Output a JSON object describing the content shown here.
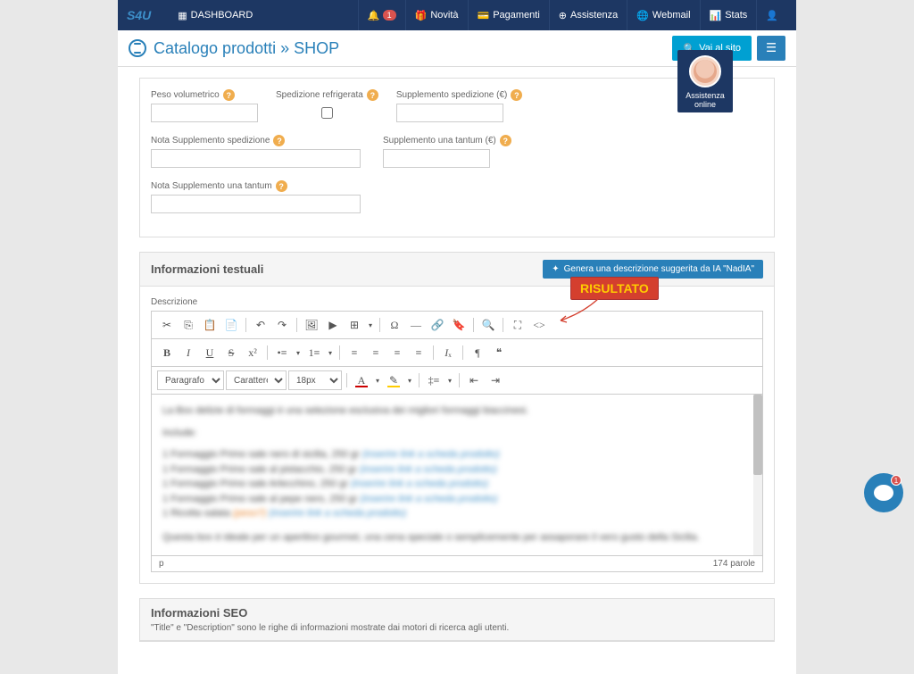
{
  "nav": {
    "brand": "S4U",
    "dashboard": "DASHBOARD",
    "bell_count": "1",
    "novita": "Novità",
    "pagamenti": "Pagamenti",
    "assistenza": "Assistenza",
    "webmail": "Webmail",
    "stats": "Stats"
  },
  "titlebar": {
    "title": "Catalogo prodotti » SHOP",
    "go_site": "Vai al sito"
  },
  "shipping": {
    "peso_label": "Peso volumetrico",
    "refrigerata_label": "Spedizione refrigerata",
    "supplemento_label": "Supplemento spedizione (€)",
    "nota_supp_label": "Nota Supplemento spedizione",
    "una_tantum_label": "Supplemento una tantum (€)",
    "nota_tantum_label": "Nota Supplemento una tantum"
  },
  "textual": {
    "title": "Informazioni testuali",
    "ai_btn": "Genera una descrizione suggerita da IA \"NadIA\"",
    "desc_label": "Descrizione",
    "paragraph": "Paragrafo",
    "font_family": "Carattere di si...",
    "font_size": "18px",
    "status_path": "p",
    "word_count": "174 parole",
    "body": {
      "intro": "La Box delizie di formaggi è una selezione esclusiva dei migliori formaggi biaccinesi.",
      "include": "Include:",
      "items": [
        {
          "t": "1 Formaggio Primo sale nero di sicilia, 250 gr",
          "l": "(inserire link a scheda prodotto)"
        },
        {
          "t": "1 Formaggio Primo sale al pistacchio, 250 gr",
          "l": "(inserire link a scheda prodotto)"
        },
        {
          "t": "1 Formaggio Primo sale Arlecchino, 250 gr",
          "l": "(inserire link a scheda prodotto)"
        },
        {
          "t": "1 Formaggio Primo sale al pepe nero, 250 gr",
          "l": "(inserire link a scheda prodotto)"
        },
        {
          "t": "1 Ricotta salata",
          "o": "(peso?)",
          "l": "(inserire link a scheda prodotto)"
        }
      ],
      "outro": "Questa box è ideale per un aperitivo gourmet, una cena speciale o semplicemente per assaporare il vero gusto della Sicilia."
    }
  },
  "seo": {
    "title": "Informazioni SEO",
    "subtitle": "\"Title\" e \"Description\" sono le righe di informazioni mostrate dai motori di ricerca agli utenti."
  },
  "annotation": {
    "label": "RISULTATO"
  },
  "assist": {
    "line1": "Assistenza",
    "line2": "online"
  },
  "chat": {
    "count": "1"
  }
}
